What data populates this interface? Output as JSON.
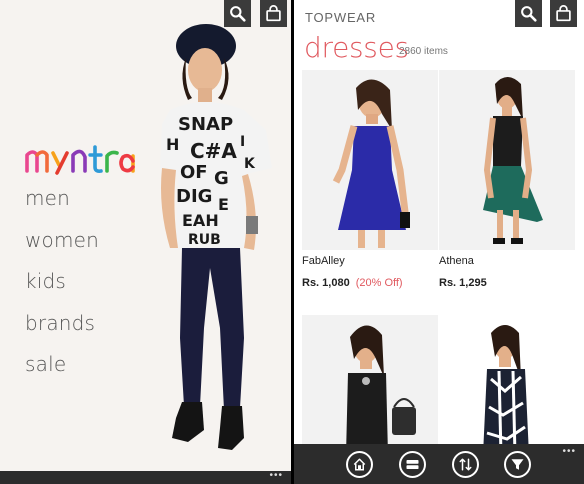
{
  "home": {
    "logo_text": "myntra",
    "nav": [
      "men",
      "women",
      "kids",
      "brands",
      "sale"
    ]
  },
  "listing": {
    "section": "TOPWEAR",
    "category": "dresses",
    "count": "2860 items",
    "products": [
      {
        "brand": "FabAlley",
        "price": "Rs. 1,080",
        "discount": "(20% Off)",
        "dress_color": "#2b2ba8"
      },
      {
        "brand": "Athena",
        "price": "Rs. 1,295",
        "discount": "",
        "dress_color": "#1e6b5c"
      },
      {
        "brand": "",
        "price": "",
        "discount": "",
        "dress_color": "#1c1c1c"
      },
      {
        "brand": "",
        "price": "",
        "discount": "",
        "dress_color": "#1c2233"
      }
    ]
  },
  "appbar": {
    "more_glyph": "•••",
    "buttons": [
      "home-icon",
      "view-toggle-icon",
      "sort-icon",
      "filter-icon"
    ]
  },
  "colors": {
    "accent": "#e0595f",
    "appbar": "#2c2c2c",
    "icon_tile": "#3b3b3b"
  }
}
